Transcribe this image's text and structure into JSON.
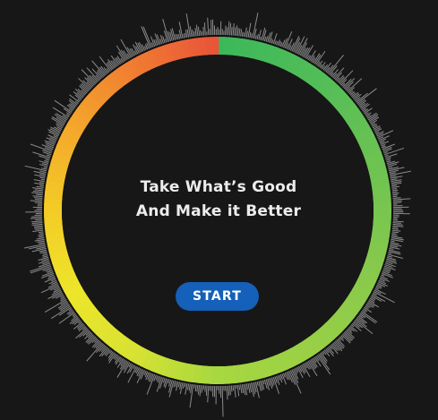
{
  "headline": {
    "line1": "Take What’s Good",
    "line2": "And Make it Better"
  },
  "start_button": {
    "label": "START"
  },
  "ring": {
    "gradient_left_colors": [
      "#e8523a",
      "#f07a32",
      "#f4a62c",
      "#f3cb26",
      "#ede52a",
      "#d8e232",
      "#a8d840"
    ],
    "gradient_right_colors": [
      "#3cb85a",
      "#52bd58",
      "#6cc352",
      "#86c94c",
      "#98cf46",
      "#a8d840"
    ],
    "waveform_color": "#8a8a8a",
    "inner_color": "#171717"
  }
}
